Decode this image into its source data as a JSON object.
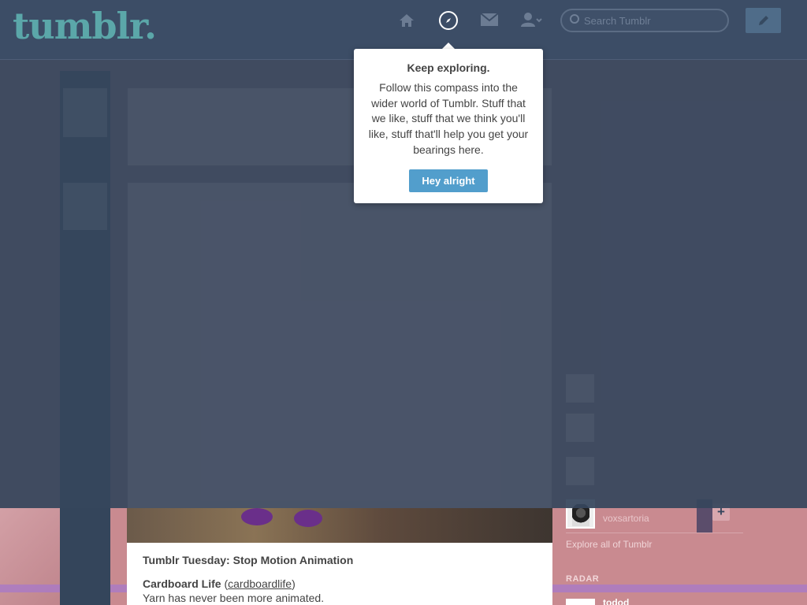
{
  "header": {
    "logo": "tumblr.",
    "search_placeholder": "Search Tumblr"
  },
  "nav": {
    "home_icon": "home-icon",
    "explore_icon": "compass-icon",
    "inbox_icon": "envelope-icon",
    "account_icon": "person-icon"
  },
  "compose": {
    "icon": "pencil-icon"
  },
  "popover": {
    "title": "Keep exploring.",
    "body": "Follow this compass into the wider world of Tumblr. Stuff that we like, stuff that we think you'll like, stuff that'll help you get your bearings here.",
    "button_label": "Hey alright"
  },
  "post": {
    "title": "Tumblr Tuesday: Stop Motion Animation",
    "line1_bold": "Cardboard Life",
    "line1_link": "cardboardlife",
    "line2": "Yarn has never been more animated."
  },
  "sidebar": {
    "recommended_blog": "voxsartoria",
    "explore_link": "Explore all of Tumblr",
    "radar_label": "RADAR",
    "radar_blog": "todod"
  },
  "colors": {
    "header_bg": "#3c4d66",
    "accent": "#529ecc",
    "logo": "#5ba7a9"
  }
}
